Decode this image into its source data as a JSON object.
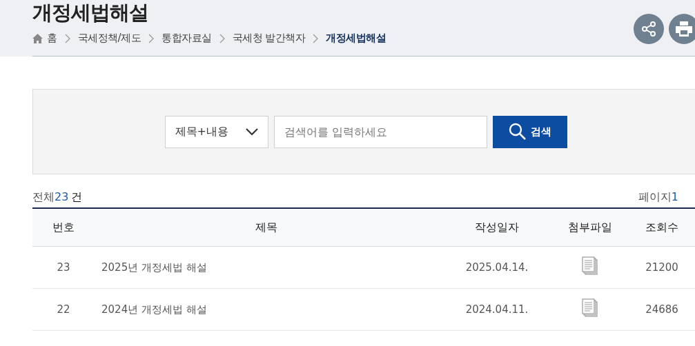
{
  "page_title": "개정세법해설",
  "breadcrumb": [
    {
      "label": "홈",
      "kind": "home",
      "current": false
    },
    {
      "label": "국세정책/제도",
      "kind": "link",
      "current": false
    },
    {
      "label": "통합자료실",
      "kind": "link",
      "current": false
    },
    {
      "label": "국세청 발간책자",
      "kind": "link",
      "current": false
    },
    {
      "label": "개정세법해설",
      "kind": "link",
      "current": true
    }
  ],
  "search": {
    "category": "제목+내용",
    "placeholder": "검색어를 입력하세요",
    "button": "검색"
  },
  "total": {
    "label": "전체",
    "count": "23",
    "unit": "건"
  },
  "paging": {
    "label": "페이지",
    "current": "1"
  },
  "table": {
    "columns": [
      "번호",
      "제목",
      "작성일자",
      "첨부파일",
      "조회수"
    ],
    "rows": [
      {
        "number": "23",
        "title": "2025년 개정세법 해설",
        "date": "2025.04.14.",
        "attachment": true,
        "views": "21200"
      },
      {
        "number": "22",
        "title": "2024년 개정세법 해설",
        "date": "2024.04.11.",
        "attachment": true,
        "views": "24686"
      }
    ]
  }
}
